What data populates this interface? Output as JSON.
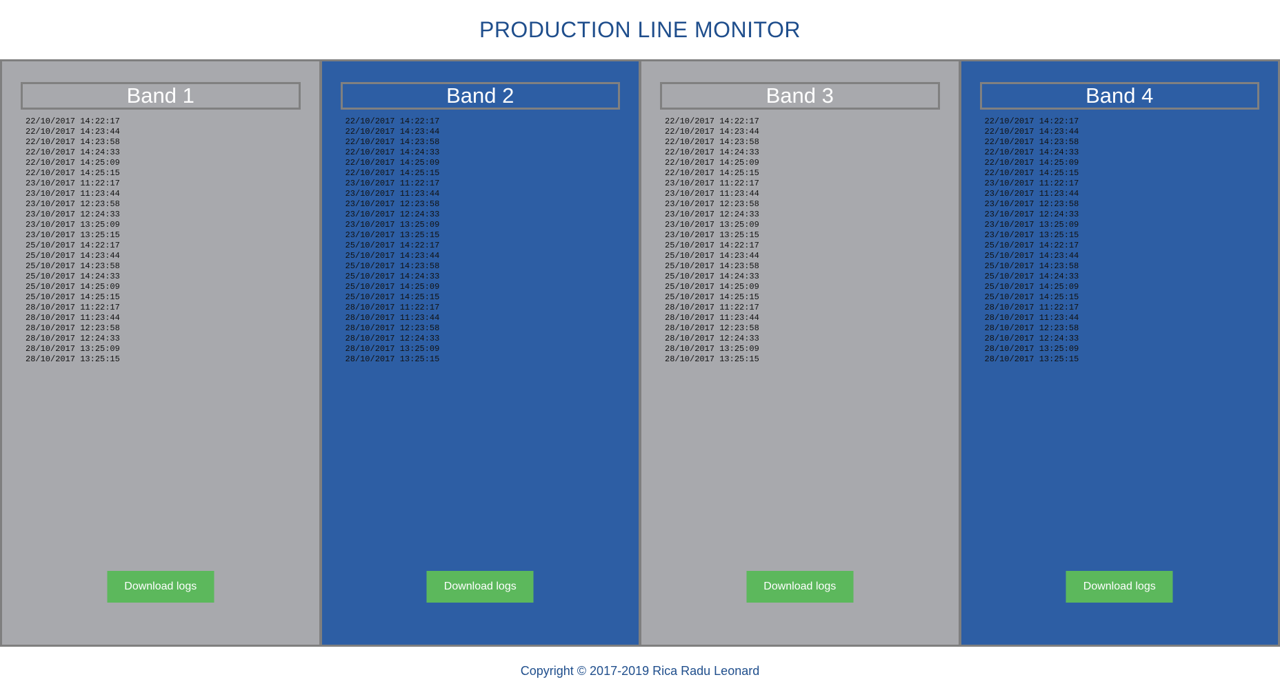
{
  "header": {
    "title": "PRODUCTION LINE MONITOR"
  },
  "colors": {
    "title": "#1f4e8c",
    "band_gray": "#a8a9ad",
    "band_blue": "#2d5ea4",
    "button_green": "#5cb85c",
    "border": "#7f7f7f"
  },
  "logs": [
    "22/10/2017 14:22:17",
    "22/10/2017 14:23:44",
    "22/10/2017 14:23:58",
    "22/10/2017 14:24:33",
    "22/10/2017 14:25:09",
    "22/10/2017 14:25:15",
    "23/10/2017 11:22:17",
    "23/10/2017 11:23:44",
    "23/10/2017 12:23:58",
    "23/10/2017 12:24:33",
    "23/10/2017 13:25:09",
    "23/10/2017 13:25:15",
    "25/10/2017 14:22:17",
    "25/10/2017 14:23:44",
    "25/10/2017 14:23:58",
    "25/10/2017 14:24:33",
    "25/10/2017 14:25:09",
    "25/10/2017 14:25:15",
    "28/10/2017 11:22:17",
    "28/10/2017 11:23:44",
    "28/10/2017 12:23:58",
    "28/10/2017 12:24:33",
    "28/10/2017 13:25:09",
    "28/10/2017 13:25:15"
  ],
  "bands": [
    {
      "title": "Band 1",
      "theme": "gray",
      "button_label": "Download logs"
    },
    {
      "title": "Band 2",
      "theme": "blue",
      "button_label": "Download logs"
    },
    {
      "title": "Band 3",
      "theme": "gray",
      "button_label": "Download logs"
    },
    {
      "title": "Band 4",
      "theme": "blue",
      "button_label": "Download logs"
    }
  ],
  "footer": {
    "copyright": "Copyright © 2017-2019 Rica Radu Leonard"
  }
}
